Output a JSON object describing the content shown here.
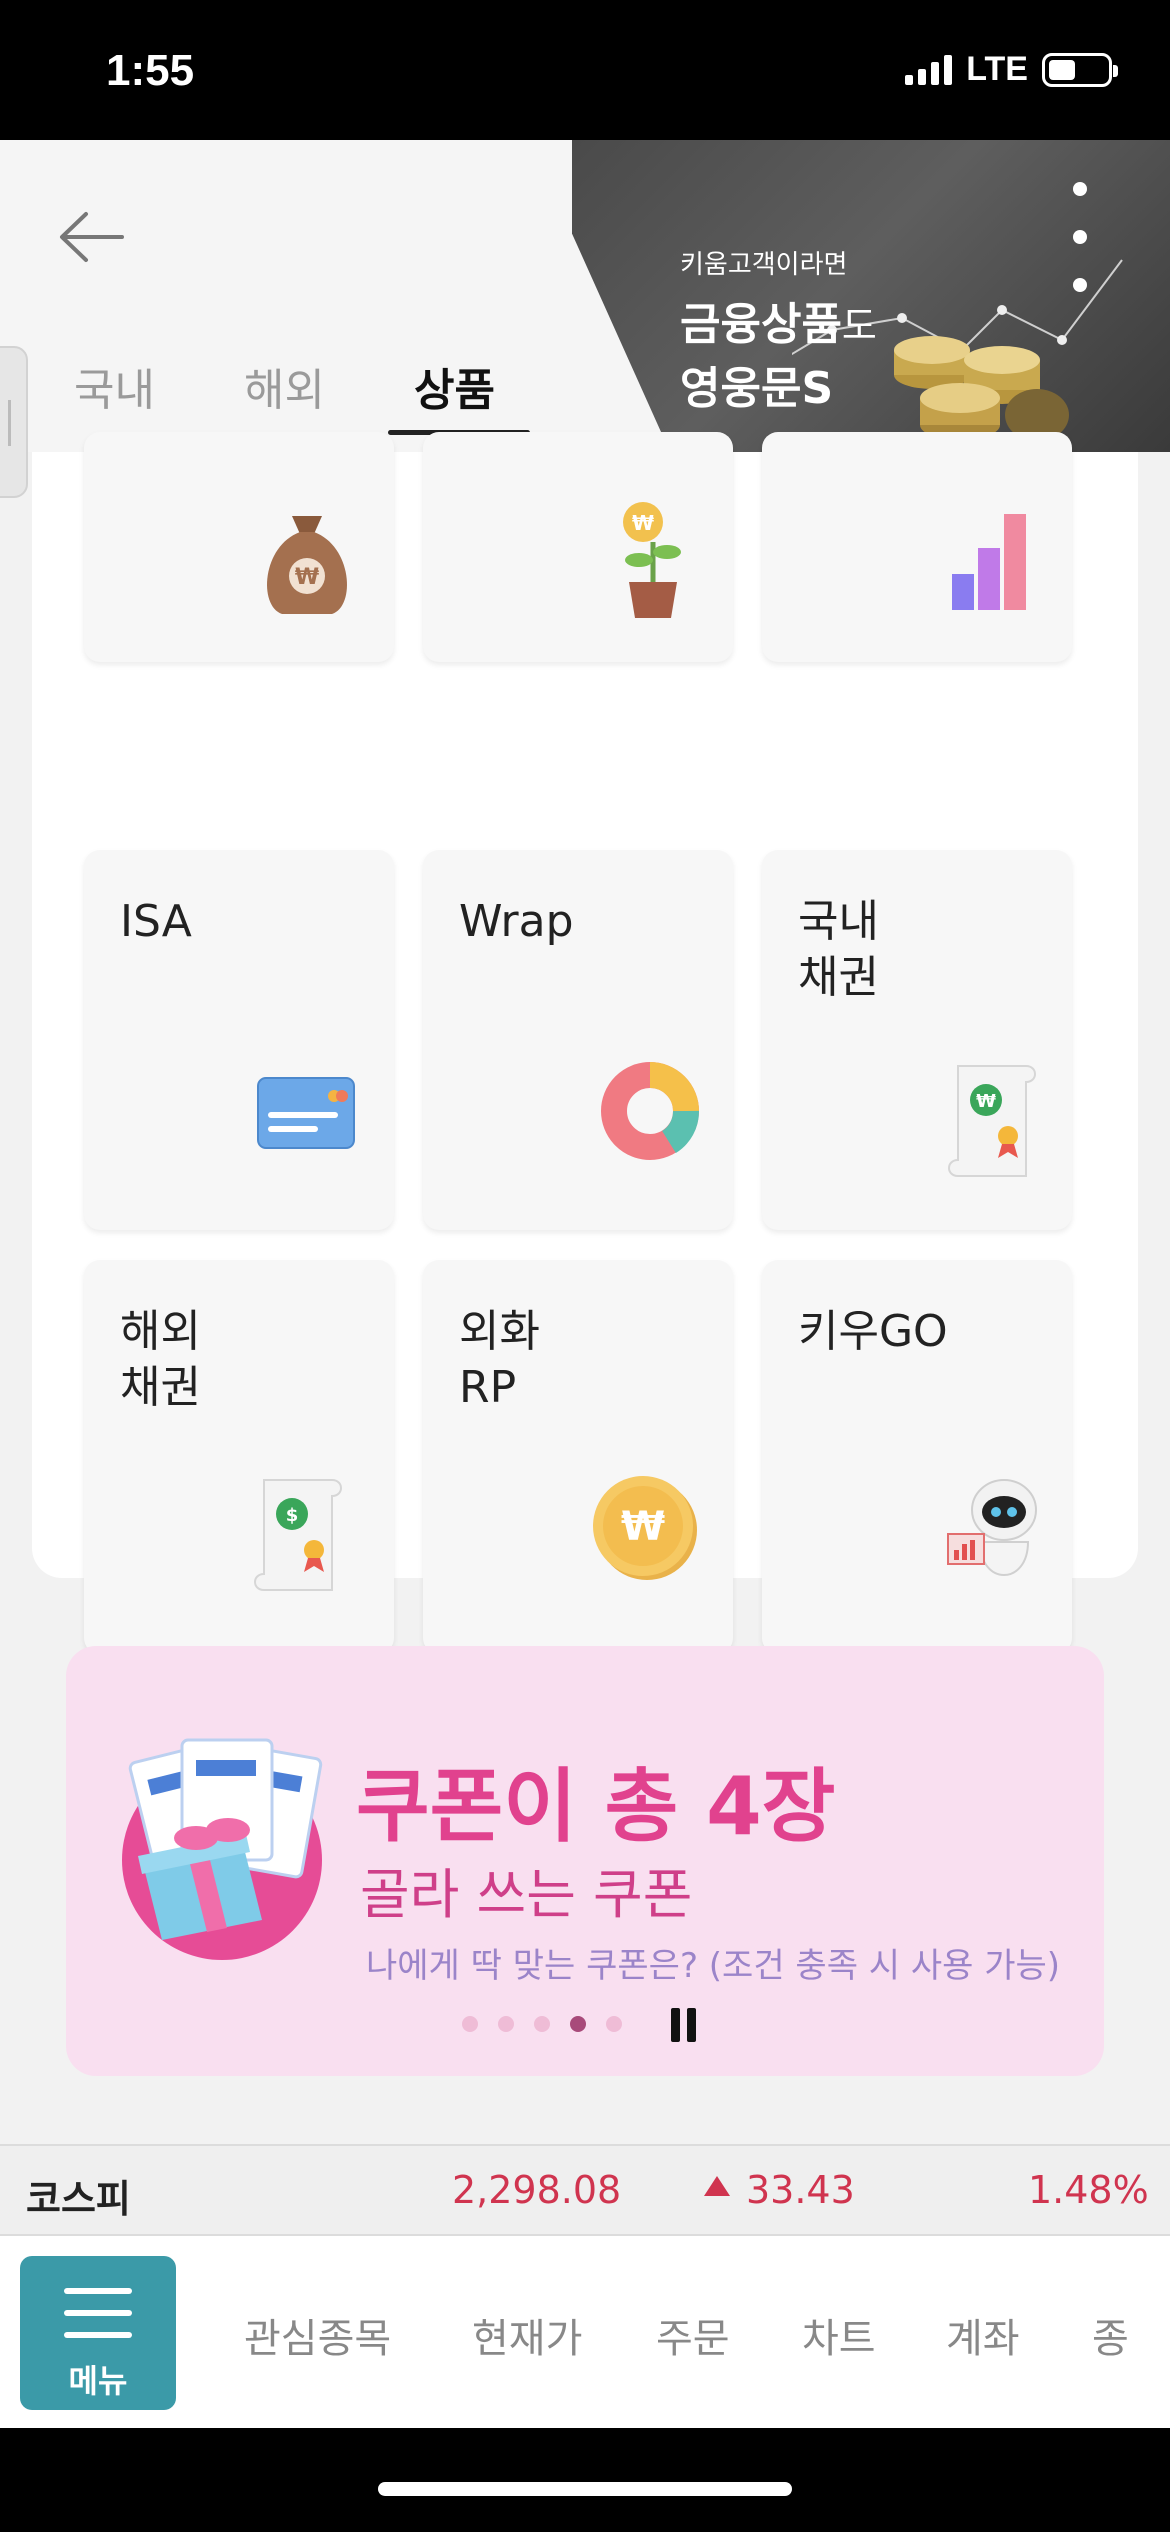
{
  "status_bar": {
    "time": "1:55",
    "network": "LTE"
  },
  "header": {
    "tabs": [
      {
        "label": "국내",
        "active": false
      },
      {
        "label": "해외",
        "active": false
      },
      {
        "label": "상품",
        "active": true
      }
    ],
    "banner": {
      "line1": "키움고객이라면",
      "line2_bold": "금융상품",
      "line2_light": "도",
      "line3": "영웅문S"
    }
  },
  "products": {
    "top_row_icons": [
      "money-bag-icon",
      "coin-plant-icon",
      "bar-chart-icon"
    ],
    "cards": [
      {
        "label": "ISA",
        "icon": "credit-card-icon"
      },
      {
        "label": "Wrap",
        "icon": "donut-chart-icon"
      },
      {
        "label": "국내\n채권",
        "icon": "won-certificate-icon"
      },
      {
        "label": "해외\n채권",
        "icon": "dollar-certificate-icon"
      },
      {
        "label": "외화\nRP",
        "icon": "won-coin-icon"
      },
      {
        "label": "키우GO",
        "icon": "robot-icon"
      }
    ]
  },
  "coupon_banner": {
    "title": "쿠폰이 총 4장",
    "subtitle": "골라 쓰는 쿠폰",
    "description": "나에게 딱 맞는 쿠폰은? (조건 충족 시 사용 가능)",
    "page_count": 5,
    "active_page": 4
  },
  "index_bar": {
    "name": "코스피",
    "value": "2,298.08",
    "change": "33.43",
    "percent": "1.48%",
    "direction": "up",
    "color": "#d0344f"
  },
  "bottom_nav": {
    "menu_label": "메뉴",
    "items": [
      "관심종목",
      "현재가",
      "주문",
      "차트",
      "계좌",
      "종"
    ]
  },
  "colors": {
    "accent_teal": "#3b9aa8",
    "coupon_pink": "#e1428e",
    "up_red": "#d0344f"
  }
}
